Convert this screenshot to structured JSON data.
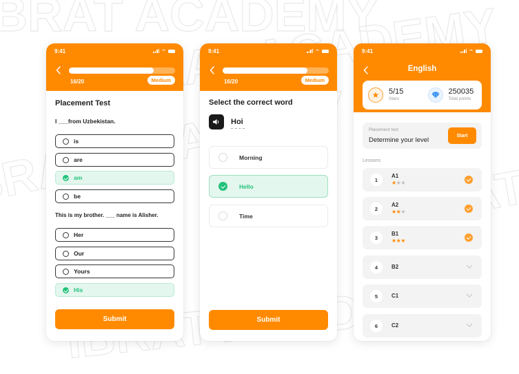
{
  "watermark": {
    "text": "IBRAT ACADEMY"
  },
  "status_bar": {
    "time": "9:41"
  },
  "placement_screen": {
    "progress_text": "16/20",
    "progress_fraction": 0.8,
    "level": "Medium",
    "title": "Placement Test",
    "questions": [
      {
        "text": "I ___from Uzbekistan.",
        "options": [
          {
            "label": "is",
            "selected": false
          },
          {
            "label": "are",
            "selected": false
          },
          {
            "label": "am",
            "selected": true
          },
          {
            "label": "be",
            "selected": false
          }
        ]
      },
      {
        "text": "This is my brother. ___ name is Alisher.",
        "options": [
          {
            "label": "Her",
            "selected": false
          },
          {
            "label": "Our",
            "selected": false
          },
          {
            "label": "Yours",
            "selected": false
          },
          {
            "label": "His",
            "selected": true
          }
        ]
      }
    ],
    "submit_label": "Submit"
  },
  "word_screen": {
    "progress_text": "16/20",
    "progress_fraction": 0.8,
    "level": "Medium",
    "title": "Select the correct word",
    "word": "Hoi",
    "options": [
      {
        "label": "Morning",
        "selected": false
      },
      {
        "label": "Hello",
        "selected": true
      },
      {
        "label": "Time",
        "selected": false
      }
    ],
    "submit_label": "Submit"
  },
  "english_screen": {
    "title": "English",
    "stars": {
      "value": "5/15",
      "label": "Stars"
    },
    "points": {
      "value": "250035",
      "label": "Total points"
    },
    "placement": {
      "label": "Placement test",
      "title": "Determine your level",
      "button": "Start"
    },
    "lessons_label": "Lessons",
    "lessons": [
      {
        "num": "1",
        "name": "A1",
        "stars": 1,
        "completed": true
      },
      {
        "num": "2",
        "name": "A2",
        "stars": 2,
        "completed": true
      },
      {
        "num": "3",
        "name": "B1",
        "stars": 3,
        "completed": true
      },
      {
        "num": "4",
        "name": "B2",
        "stars": 0,
        "completed": false
      },
      {
        "num": "5",
        "name": "C1",
        "stars": 0,
        "completed": false
      },
      {
        "num": "6",
        "name": "C2",
        "stars": 0,
        "completed": false
      }
    ]
  },
  "colors": {
    "accent": "#ff8a00",
    "success": "#22c27a"
  }
}
